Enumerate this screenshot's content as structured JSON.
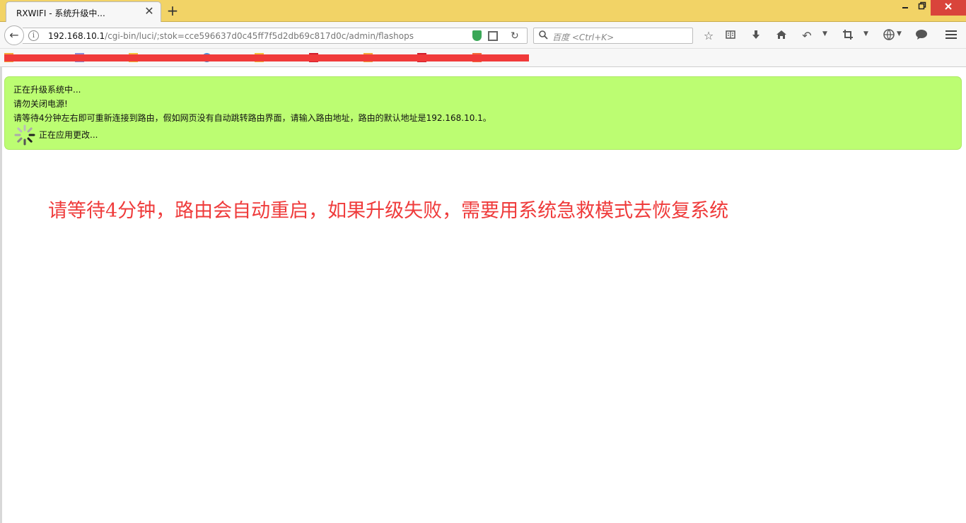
{
  "browser": {
    "tab_title": "RXWIFI - 系统升级中...",
    "tab_close_glyph": "✕",
    "newtab_glyph": "+",
    "url_host": "192.168.10.1",
    "url_path": "/cgi-bin/luci/;stok=cce596637d0c45ff7f5d2db69c817d0c/admin/flashops",
    "search_placeholder": "百度 <Ctrl+K>",
    "icons": [
      "back-icon",
      "info-icon",
      "shield-icon",
      "qr-code-icon",
      "reload-icon",
      "search-icon",
      "bookmark-star-icon",
      "reading-list-icon",
      "download-icon",
      "home-icon",
      "undo-icon",
      "crop-icon",
      "extension-icon",
      "chat-icon",
      "menu-icon"
    ]
  },
  "page": {
    "notice_lines": [
      "正在升级系统中...",
      "请勿关闭电源!",
      "请等待4分钟左右即可重新连接到路由，假如网页没有自动跳转路由界面，请输入路由地址，路由的默认地址是192.168.10.1。"
    ],
    "applying_text": "正在应用更改...",
    "annotation_text": "请等待4分钟，路由会自动重启，如果升级失败，需要用系统急救模式去恢复系统"
  },
  "colors": {
    "tabstrip": "#f2d366",
    "notice_bg": "#bcfd72",
    "annotation": "#ef3b3b",
    "redaction": "#f03a3a"
  }
}
